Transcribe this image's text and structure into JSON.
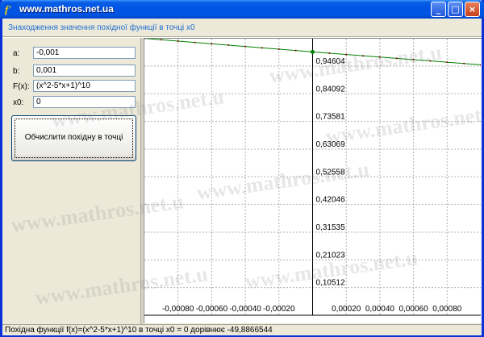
{
  "window": {
    "title": "www.mathros.net.ua",
    "buttons": {
      "minimize": "_",
      "maximize": "□",
      "close": "×"
    }
  },
  "header": {
    "subtitle": "Знаходження значення похідної функції в точці x0"
  },
  "form": {
    "fields": [
      {
        "label": "a:",
        "value": "-0,001"
      },
      {
        "label": "b:",
        "value": "0,001"
      },
      {
        "label": "F(x):",
        "value": "(x^2-5*x+1)^10"
      },
      {
        "label": "x0:",
        "value": "0"
      }
    ],
    "calc_button": "Обчислити похідну в точці"
  },
  "chart_data": {
    "type": "line",
    "xlim": [
      -0.001,
      0.001
    ],
    "ylim": [
      0.0,
      1.05
    ],
    "x_ticks": [
      "-0,00080",
      "-0,00060",
      "-0,00040",
      "-0,00020",
      "0,00020",
      "0,00040",
      "0,00060",
      "0,00080"
    ],
    "x_tick_values": [
      -0.0008,
      -0.0006,
      -0.0004,
      -0.0002,
      0.0002,
      0.0004,
      0.0006,
      0.0008
    ],
    "y_ticks": [
      "0,10512",
      "0,21023",
      "0,31535",
      "0,42046",
      "0,52558",
      "0,63069",
      "0,73581",
      "0,84092",
      "0,94604"
    ],
    "y_tick_values": [
      0.10512,
      0.21023,
      0.31535,
      0.42046,
      0.52558,
      0.63069,
      0.73581,
      0.84092,
      0.94604
    ],
    "series": [
      {
        "x": [
          -0.001,
          -0.0005,
          0.0,
          0.0005,
          0.001
        ],
        "y": [
          1.0512,
          1.0254,
          1.0,
          0.9752,
          0.951
        ]
      }
    ],
    "highlight_point": {
      "x": 0.0,
      "y": 1.0
    },
    "line_color": "#008000",
    "dot_color": "#800000",
    "grid": true
  },
  "watermark_text": "www.mathros.net.u",
  "status": {
    "text": "Похідна функції f(x)=(x^2-5*x+1)^10 в точці x0 = 0 дорівнює -49,8866544"
  }
}
